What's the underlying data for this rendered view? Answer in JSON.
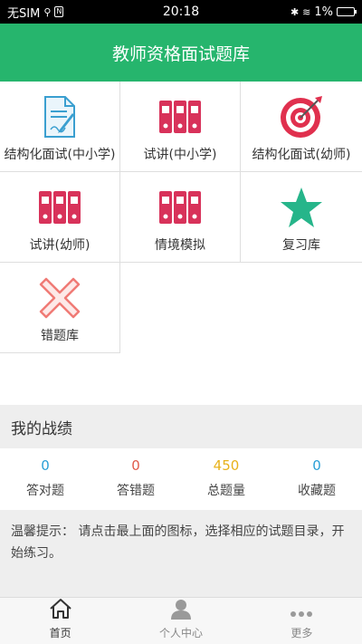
{
  "status_bar": {
    "carrier": "无SIM",
    "time": "20:18",
    "battery": "1%"
  },
  "header": {
    "title": "教师资格面试题库"
  },
  "tiles": [
    {
      "label": "结构化面试(中小学)",
      "icon": "document-pen-icon"
    },
    {
      "label": "试讲(中小学)",
      "icon": "binders-icon"
    },
    {
      "label": "结构化面试(幼师)",
      "icon": "target-icon"
    },
    {
      "label": "试讲(幼师)",
      "icon": "binders-icon"
    },
    {
      "label": "情境模拟",
      "icon": "binders-icon"
    },
    {
      "label": "复习库",
      "icon": "star-icon"
    },
    {
      "label": "错题库",
      "icon": "cross-icon"
    }
  ],
  "achievements": {
    "title": "我的战绩",
    "stats": [
      {
        "value": "0",
        "label": "答对题",
        "color": "#2a9fd6"
      },
      {
        "value": "0",
        "label": "答错题",
        "color": "#e05a4a"
      },
      {
        "value": "450",
        "label": "总题量",
        "color": "#e8b21b"
      },
      {
        "value": "0",
        "label": "收藏题",
        "color": "#2a9fd6"
      }
    ]
  },
  "tip": {
    "text": "温馨提示： 请点击最上面的图标，选择相应的试题目录，开始练习。"
  },
  "tabs": [
    {
      "label": "首页",
      "icon": "home-icon"
    },
    {
      "label": "个人中心",
      "icon": "user-icon"
    },
    {
      "label": "更多",
      "icon": "more-icon"
    }
  ],
  "colors": {
    "brand": "#26b56d",
    "binder": "#d8325a",
    "target": "#e0304e",
    "star": "#26b58a",
    "cross": "#f07a75"
  }
}
